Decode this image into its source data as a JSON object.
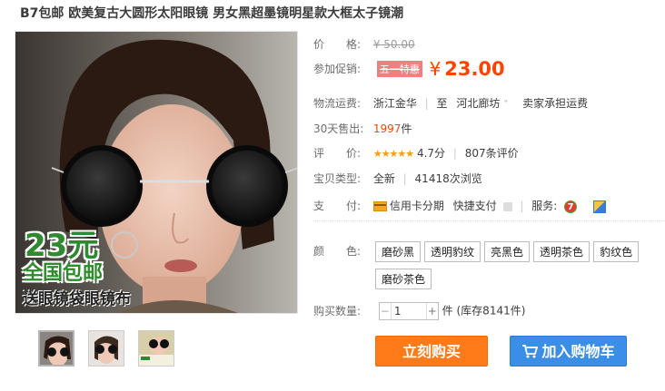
{
  "title": "B7包邮 欧美复古大圆形太阳眼镜 男女黑超墨镜明星款大框太子镜潮",
  "image_promo": {
    "price": "23元",
    "free_shipping": "全国包邮",
    "gift": "送眼镜袋眼镜布"
  },
  "price": {
    "label": "价　　格:",
    "original": "¥ 50.00"
  },
  "promo": {
    "label": "参加促销:",
    "tag": "五一特惠",
    "currency": "¥",
    "price": "23.00"
  },
  "shipping": {
    "label": "物流运费:",
    "from": "浙江金华",
    "to_prefix": "至",
    "to": "河北廊坊",
    "fee": "卖家承担运费"
  },
  "sales": {
    "label": "30天售出:",
    "count": "1997",
    "unit": "件"
  },
  "rating": {
    "label": "评　　价:",
    "stars": "★★★★★",
    "score": "4.7分",
    "reviews": "807条评价"
  },
  "type": {
    "label": "宝贝类型:",
    "condition": "全新",
    "views": "41418次浏览"
  },
  "payment": {
    "label": "支　　付:",
    "credit": "信用卡分期",
    "fastpay": "快捷支付",
    "service_label": "服务:"
  },
  "color": {
    "label": "颜　　色:",
    "options": [
      "磨砂黑",
      "透明豹纹",
      "亮黑色",
      "透明茶色",
      "豹纹色",
      "磨砂茶色"
    ]
  },
  "quantity": {
    "label": "购买数量:",
    "value": "1",
    "unit": "件",
    "stock": "(库存8141件)"
  },
  "buttons": {
    "buy": "立刻购买",
    "cart": "加入购物车"
  },
  "colors_theme": {
    "accent": "#ff4400",
    "buy": "#ff7b1a",
    "cart": "#3a8ee6",
    "promo_green": "#2f8a2f"
  }
}
